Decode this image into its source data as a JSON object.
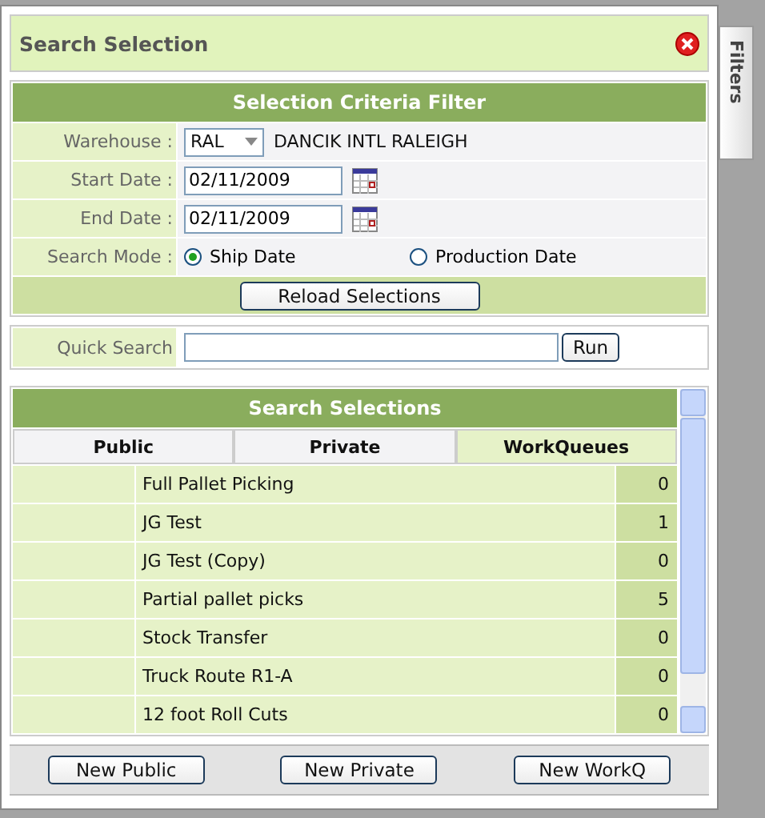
{
  "dialog": {
    "title": "Search Selection"
  },
  "side_tab": {
    "label": "Filters"
  },
  "criteria": {
    "heading": "Selection Criteria Filter",
    "warehouse": {
      "label": "Warehouse :",
      "value": "RAL",
      "name": "DANCIK INTL RALEIGH"
    },
    "start_date": {
      "label": "Start Date :",
      "value": "02/11/2009"
    },
    "end_date": {
      "label": "End Date :",
      "value": "02/11/2009"
    },
    "search_mode": {
      "label": "Search Mode :",
      "options": [
        {
          "label": "Ship Date",
          "selected": true
        },
        {
          "label": "Production Date",
          "selected": false
        }
      ]
    },
    "reload_button": "Reload Selections"
  },
  "quick_search": {
    "label": "Quick Search",
    "run_button": "Run"
  },
  "selections": {
    "heading": "Search Selections",
    "tabs": [
      {
        "label": "Public",
        "selected": false
      },
      {
        "label": "Private",
        "selected": false
      },
      {
        "label": "WorkQueues",
        "selected": true
      }
    ],
    "rows": [
      {
        "name": "Full Pallet Picking",
        "count": "0"
      },
      {
        "name": "JG Test",
        "count": "1"
      },
      {
        "name": "JG Test (Copy)",
        "count": "0"
      },
      {
        "name": "Partial pallet picks",
        "count": "5"
      },
      {
        "name": "Stock Transfer",
        "count": "0"
      },
      {
        "name": "Truck Route R1-A",
        "count": "0"
      },
      {
        "name": "12 foot Roll Cuts",
        "count": "0"
      }
    ]
  },
  "footer_buttons": [
    "New Public",
    "New Private",
    "New WorkQ"
  ]
}
